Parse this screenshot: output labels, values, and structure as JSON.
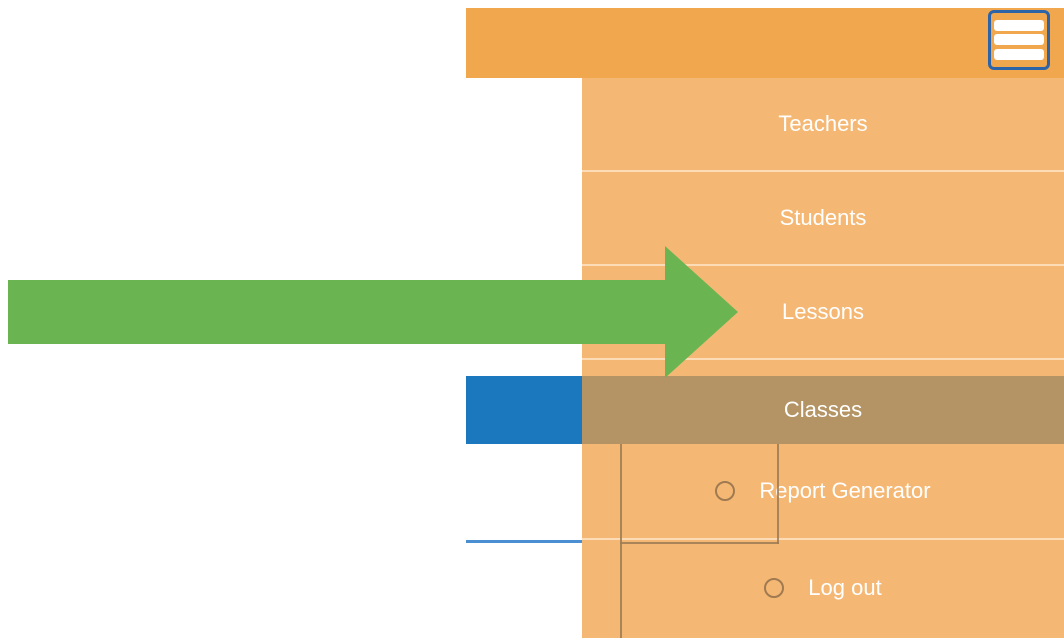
{
  "header": {
    "menu_button_icon": "hamburger-menu-icon",
    "accent_color": "#f1a74e"
  },
  "menu": {
    "items": [
      {
        "label": "Teachers"
      },
      {
        "label": "Students"
      },
      {
        "label": "Lessons"
      },
      {
        "label": "Classes",
        "active": true
      }
    ],
    "subitems": [
      {
        "label": "Report Generator",
        "icon": "radio-circle-icon"
      },
      {
        "label": "Log out",
        "icon": "radio-circle-icon"
      }
    ],
    "background_color": "#f5b874",
    "active_color": "#b49464"
  },
  "overlay": {
    "annotation": "green-arrow-pointer",
    "arrow_color": "#6ab552"
  },
  "background_panel": {
    "accent_color": "#1b78bf"
  }
}
